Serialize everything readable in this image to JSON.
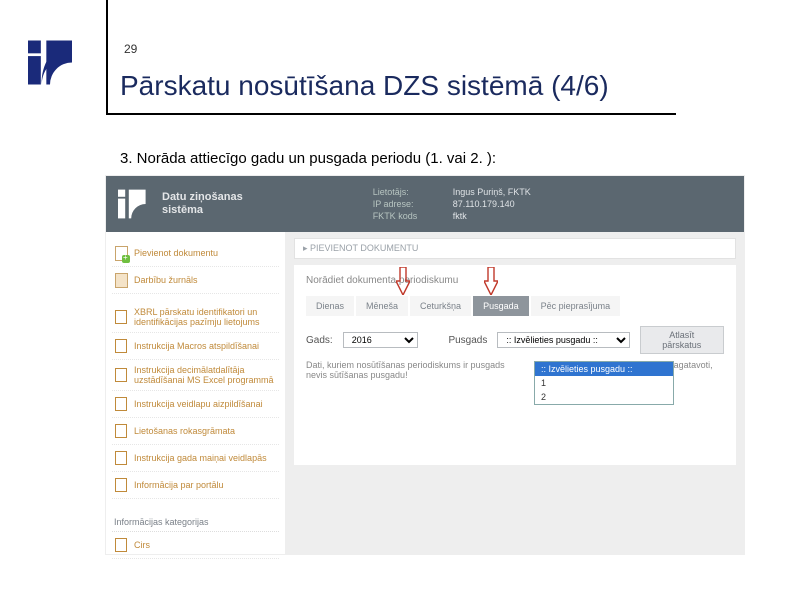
{
  "page_number": "29",
  "title": "Pārskatu nosūtīšana DZS sistēmā (4/6)",
  "step": "3. Norāda attiecīgo gadu un pusgada periodu (1. vai 2. ):",
  "app": {
    "brand_line1": "Datu ziņošanas",
    "brand_line2": "sistēma",
    "user_labels": {
      "user": "Lietotājs:",
      "ip": "IP adrese:",
      "code": "FKTK kods"
    },
    "user_values": {
      "user": "Ingus Puriņš, FKTK",
      "ip": "87.110.179.140",
      "code": "fktk"
    }
  },
  "sidebar": {
    "primary": [
      {
        "label": "Pievienot dokumentu"
      },
      {
        "label": "Darbību žurnāls"
      }
    ],
    "docs": [
      "XBRL pārskatu identifikatori un identifikācijas pazīmju lietojums",
      "Instrukcija Macros atspildīšanai",
      "Instrukcija decimālatdalītāja uzstādīšanai MS Excel programmā",
      "Instrukcija veidlapu aizpildīšanai",
      "Lietošanas rokasgrāmata",
      "Instrukcija gada maiņai veidlapās",
      "Informācija par portālu"
    ],
    "category_heading": "Informācijas kategorijas",
    "categories": [
      "Cirs"
    ]
  },
  "main": {
    "breadcrumb": "▸ PIEVIENOT DOKUMENTU",
    "panel_title": "Norādiet dokumenta periodiskumu",
    "tabs": [
      "Dienas",
      "Mēneša",
      "Ceturkšņa",
      "Pusgada",
      "Pēc pieprasījuma"
    ],
    "active_tab": 3,
    "year_label": "Gads:",
    "year_value": "2016",
    "half_label": "Pusgads",
    "half_placeholder": ":: Izvēlieties pusgadu ::",
    "half_options": [
      ":: Izvēlieties pusgadu ::",
      "1",
      "2"
    ],
    "select_button": "Atlasīt pārskatus",
    "note_prefix": "Dati, kuriem nosūtīšanas periodiskums ir pusgads",
    "note_suffix": "ādu dati ir sagatavoti, nevis sūtīšanas pusgadu!"
  }
}
